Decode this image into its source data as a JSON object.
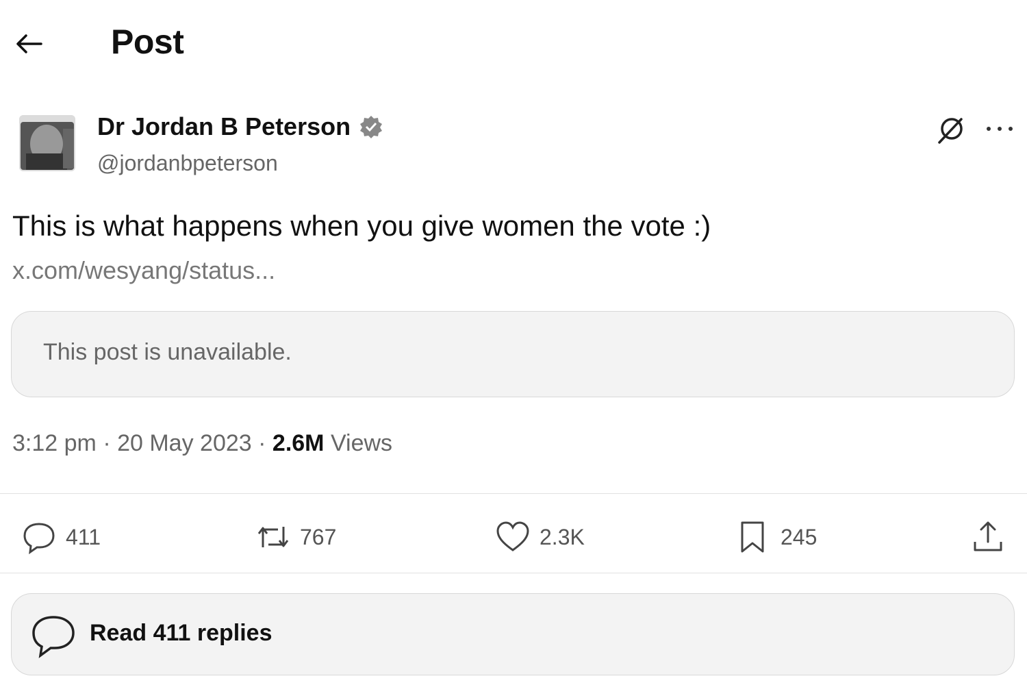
{
  "header": {
    "title": "Post"
  },
  "author": {
    "name": "Dr Jordan B Peterson",
    "handle": "@jordanbpeterson"
  },
  "post": {
    "text": "This is what happens when you give women the vote :)",
    "link": "x.com/wesyang/status...",
    "quoted_post_notice": "This post is unavailable.",
    "time": "3:12 pm",
    "date": "20 May 2023",
    "views_count": "2.6M",
    "views_label": "Views",
    "separator": "·"
  },
  "actions": {
    "replies": "411",
    "reposts": "767",
    "likes": "2.3K",
    "bookmarks": "245"
  },
  "read_replies": {
    "label": "Read 411 replies"
  },
  "icons": {
    "back": "arrow-left-icon",
    "verified": "verified-badge-icon",
    "grok": "grok-icon",
    "more": "more-dots-icon",
    "reply": "reply-bubble-icon",
    "repost": "repost-icon",
    "like": "heart-icon",
    "bookmark": "bookmark-icon",
    "share": "share-icon"
  },
  "colors": {
    "text": "#111111",
    "muted": "#666666",
    "card_bg": "#f3f3f3",
    "border": "#d8d8d8"
  }
}
